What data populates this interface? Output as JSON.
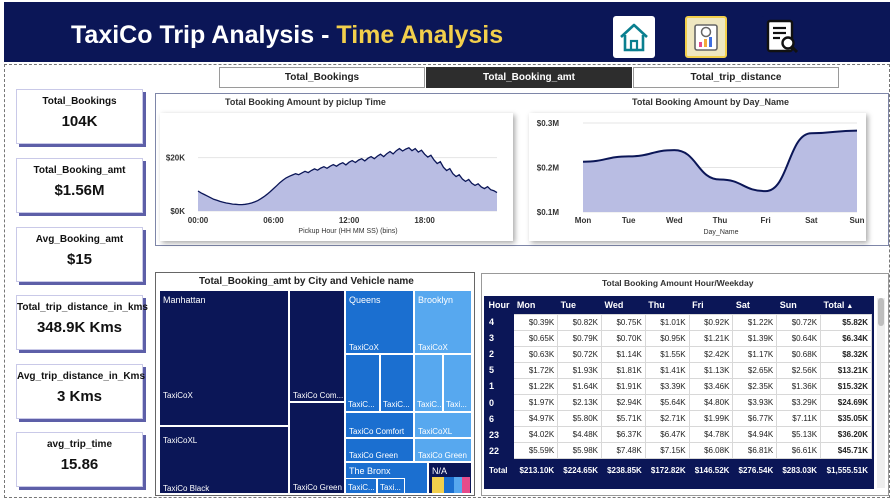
{
  "header": {
    "title": "TaxiCo Trip Analysis",
    "separator": "-",
    "subtitle": "Time Analysis",
    "nav": [
      {
        "icon": "home-icon",
        "state": "inactive"
      },
      {
        "icon": "report-chart-icon",
        "state": "active"
      },
      {
        "icon": "document-search-icon",
        "state": "inactive"
      }
    ]
  },
  "tabs": [
    {
      "label": "Total_Bookings",
      "active": false
    },
    {
      "label": "Total_Booking_amt",
      "active": true
    },
    {
      "label": "Total_trip_distance",
      "active": false
    }
  ],
  "kpis": [
    {
      "label": "Total_Bookings",
      "value": "104K"
    },
    {
      "label": "Total_Booking_amt",
      "value": "$1.56M"
    },
    {
      "label": "Avg_Booking_amt",
      "value": "$15"
    },
    {
      "label": "Total_trip_distance_in_kms",
      "value": "348.9K Kms"
    },
    {
      "label": "Avg_trip_distance_in_Kms",
      "value": "3 Kms"
    },
    {
      "label": "avg_trip_time",
      "value": "15.86"
    }
  ],
  "chart_data": [
    {
      "type": "area",
      "title": "Total Booking Amount by piclup Time",
      "xlabel": "Pickup Hour (HH MM SS) (bins)",
      "ylabel": "",
      "x_ticks": [
        "00:00",
        "06:00",
        "12:00",
        "18:00"
      ],
      "y_ticks": [
        "$0K",
        "$20K"
      ],
      "ylim": [
        0,
        30
      ],
      "x": [
        0,
        1,
        2,
        3,
        4,
        5,
        6,
        7,
        8,
        9,
        10,
        11,
        12,
        13,
        14,
        15,
        16,
        17,
        18,
        19,
        20,
        21,
        22,
        23,
        24,
        25,
        26,
        27,
        28,
        29,
        30,
        31,
        32,
        33,
        34,
        35,
        36,
        37,
        38,
        39,
        40,
        41,
        42,
        43,
        44,
        45,
        46,
        47,
        48,
        49,
        50,
        51,
        52,
        53,
        54,
        55,
        56,
        57,
        58,
        59,
        60,
        61,
        62,
        63,
        64,
        65,
        66,
        67,
        68,
        69,
        70,
        71,
        72,
        73,
        74,
        75,
        76,
        77,
        78,
        79,
        80,
        81,
        82,
        83,
        84,
        85,
        86,
        87,
        88,
        89,
        90,
        91,
        92,
        93,
        94,
        95
      ],
      "values": [
        7.5,
        6.8,
        6.2,
        5.6,
        5.0,
        4.4,
        4.0,
        3.6,
        3.3,
        3.0,
        2.8,
        2.6,
        2.5,
        2.4,
        2.4,
        2.5,
        2.7,
        3.0,
        3.4,
        3.9,
        4.6,
        5.4,
        6.3,
        7.3,
        8.4,
        9.5,
        10.6,
        11.6,
        12.4,
        13.0,
        13.5,
        14.0,
        13.6,
        14.3,
        14.9,
        14.4,
        15.2,
        15.8,
        15.3,
        16.1,
        16.6,
        16.0,
        16.8,
        17.4,
        16.8,
        17.6,
        18.1,
        17.3,
        18.3,
        18.9,
        18.2,
        19.1,
        19.6,
        18.8,
        19.8,
        20.4,
        19.6,
        20.6,
        21.3,
        20.4,
        21.5,
        22.3,
        21.4,
        22.6,
        23.4,
        22.5,
        23.2,
        23.7,
        22.6,
        23.4,
        22.1,
        22.8,
        21.3,
        20.2,
        20.9,
        19.1,
        17.8,
        18.5,
        16.4,
        15.2,
        15.9,
        14.0,
        12.9,
        13.6,
        12.0,
        11.1,
        11.8,
        10.4,
        9.6,
        10.2,
        9.0,
        8.4,
        9.1,
        8.0,
        7.6,
        6.9
      ]
    },
    {
      "type": "area",
      "title": "Total Booking Amount by Day_Name",
      "xlabel": "Day_Name",
      "ylabel": "",
      "categories": [
        "Mon",
        "Tue",
        "Wed",
        "Thu",
        "Fri",
        "Sat",
        "Sun"
      ],
      "values": [
        0.213,
        0.225,
        0.239,
        0.173,
        0.147,
        0.277,
        0.283
      ],
      "y_ticks": [
        "$0.1M",
        "$0.2M",
        "$0.3M"
      ],
      "ylim": [
        0.1,
        0.3
      ]
    },
    {
      "type": "heatmap",
      "title": "Total_Booking_amt by City and Vehicle name",
      "cities": [
        {
          "name": "Manhattan",
          "vehicles": [
            {
              "name": "TaxiCoX",
              "value": 0
            },
            {
              "name": "TaxiCo Com...",
              "value": 0
            },
            {
              "name": "TaxiCoXL",
              "value": 0
            },
            {
              "name": "TaxiCo Black",
              "value": 0
            },
            {
              "name": "TaxiCo Green",
              "value": 0
            }
          ]
        },
        {
          "name": "Queens",
          "vehicles": [
            {
              "name": "TaxiCoX",
              "value": 0
            },
            {
              "name": "TaxiC...",
              "value": 0
            },
            {
              "name": "TaxiC...",
              "value": 0
            },
            {
              "name": "TaxiCo Comfort",
              "value": 0
            },
            {
              "name": "TaxiCo Green",
              "value": 0
            }
          ]
        },
        {
          "name": "Brooklyn",
          "vehicles": [
            {
              "name": "TaxiCoX",
              "value": 0
            },
            {
              "name": "TaxiC...",
              "value": 0
            },
            {
              "name": "Taxi...",
              "value": 0
            },
            {
              "name": "TaxiCoXL",
              "value": 0
            },
            {
              "name": "TaxiCo Green",
              "value": 0
            }
          ]
        },
        {
          "name": "The Bronx",
          "vehicles": [
            {
              "name": "TaxiC...",
              "value": 0
            },
            {
              "name": "Taxi...",
              "value": 0
            }
          ]
        },
        {
          "name": "N/A",
          "vehicles": []
        }
      ]
    }
  ],
  "matrix": {
    "title": "Total Booking Amount Hour/Weekday",
    "columns": [
      "Hour",
      "Mon",
      "Tue",
      "Wed",
      "Thu",
      "Fri",
      "Sat",
      "Sun",
      "Total"
    ],
    "rows": [
      [
        "4",
        "$0.39K",
        "$0.82K",
        "$0.75K",
        "$1.01K",
        "$0.92K",
        "$1.22K",
        "$0.72K",
        "$5.82K"
      ],
      [
        "3",
        "$0.65K",
        "$0.79K",
        "$0.70K",
        "$0.95K",
        "$1.21K",
        "$1.39K",
        "$0.64K",
        "$6.34K"
      ],
      [
        "2",
        "$0.63K",
        "$0.72K",
        "$1.14K",
        "$1.55K",
        "$2.42K",
        "$1.17K",
        "$0.68K",
        "$8.32K"
      ],
      [
        "5",
        "$1.72K",
        "$1.93K",
        "$1.81K",
        "$1.41K",
        "$1.13K",
        "$2.65K",
        "$2.56K",
        "$13.21K"
      ],
      [
        "1",
        "$1.22K",
        "$1.64K",
        "$1.91K",
        "$3.39K",
        "$3.46K",
        "$2.35K",
        "$1.36K",
        "$15.32K"
      ],
      [
        "0",
        "$1.97K",
        "$2.13K",
        "$2.94K",
        "$5.64K",
        "$4.80K",
        "$3.93K",
        "$3.29K",
        "$24.69K"
      ],
      [
        "6",
        "$4.97K",
        "$5.80K",
        "$5.71K",
        "$2.71K",
        "$1.99K",
        "$6.77K",
        "$7.11K",
        "$35.05K"
      ],
      [
        "23",
        "$4.02K",
        "$4.48K",
        "$6.37K",
        "$6.47K",
        "$4.78K",
        "$4.94K",
        "$5.13K",
        "$36.20K"
      ],
      [
        "22",
        "$5.59K",
        "$5.98K",
        "$7.48K",
        "$7.15K",
        "$6.08K",
        "$6.81K",
        "$6.61K",
        "$45.71K"
      ]
    ],
    "total_row": [
      "Total",
      "$213.10K",
      "$224.65K",
      "$238.85K",
      "$172.82K",
      "$146.52K",
      "$276.54K",
      "$283.03K",
      "$1,555.51K"
    ],
    "sort_indicator": "▲"
  },
  "colors": {
    "header_bg": "#0b1657",
    "accent": "#f2cf4c",
    "area_fill": "#b9bde3",
    "line": "#0b1657"
  }
}
